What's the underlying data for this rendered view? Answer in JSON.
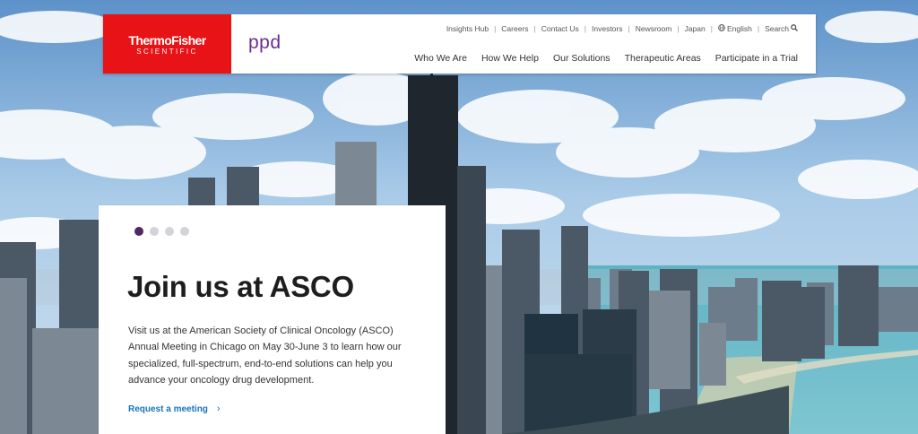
{
  "header": {
    "logo": {
      "main": "ThermoFisher",
      "sub": "SCIENTIFIC"
    },
    "partner_logo": "ppd",
    "utility_nav": {
      "insights": "Insights Hub",
      "careers": "Careers",
      "contact": "Contact Us",
      "investors": "Investors",
      "newsroom": "Newsroom",
      "japan": "Japan",
      "language": "English",
      "search": "Search"
    },
    "main_nav": {
      "who": "Who We Are",
      "how": "How We Help",
      "solutions": "Our Solutions",
      "areas": "Therapeutic Areas",
      "trial": "Participate in a Trial"
    }
  },
  "hero": {
    "carousel": {
      "slide_count": 4,
      "active_slide": 1
    },
    "title": "Join us at ASCO",
    "body": "Visit us at the American Society of Clinical Oncology (ASCO) Annual Meeting in Chicago on May 30-June 3 to learn how our specialized, full-spectrum, end-to-end solutions can help you advance your oncology drug development.",
    "cta": "Request a meeting"
  },
  "colors": {
    "brand_red": "#e71316",
    "ppd_purple": "#6b2c91",
    "dot_active": "#4e2a63",
    "dot_inactive": "#d3d3da",
    "link_blue": "#1a73b8"
  },
  "icons": {
    "language": "globe-icon",
    "search": "search-icon",
    "cta": "chevron-right-icon"
  }
}
